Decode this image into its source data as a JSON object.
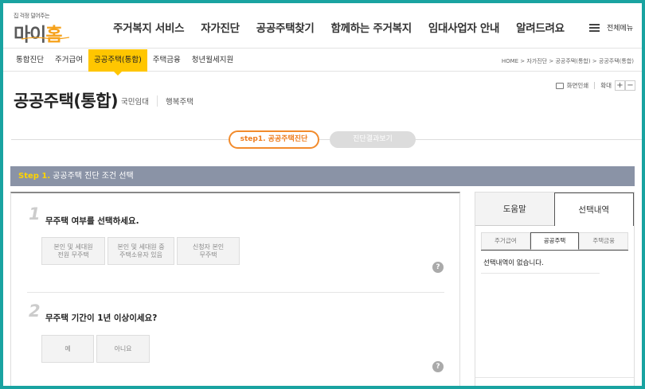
{
  "header": {
    "logo_tagline": "집 걱정 덜어주는",
    "logo_text_a": "마이",
    "logo_text_b": "홈",
    "nav": [
      {
        "label": "주거복지 서비스",
        "active": false
      },
      {
        "label": "자가진단",
        "active": true
      },
      {
        "label": "공공주택찾기",
        "active": false
      },
      {
        "label": "함께하는 주거복지",
        "active": false
      },
      {
        "label": "임대사업자 안내",
        "active": false
      },
      {
        "label": "알려드려요",
        "active": false
      }
    ],
    "all_menu_label": "전체메뉴"
  },
  "subnav": {
    "items": [
      {
        "label": "통합진단",
        "active": false
      },
      {
        "label": "주거급여",
        "active": false
      },
      {
        "label": "공공주택(통합)",
        "active": true
      },
      {
        "label": "주택금융",
        "active": false
      },
      {
        "label": "청년월세지원",
        "active": false
      }
    ],
    "breadcrumb": "HOME > 자가진단 > 공공주택(통합) > 공공주택(통합)"
  },
  "page": {
    "title": "공공주택(통합)",
    "links": [
      "국민임대",
      "행복주택"
    ],
    "print_label": "화면인쇄",
    "zoom_label": "확대",
    "zoom_in": "+",
    "zoom_out": "−"
  },
  "steps": {
    "step1": "step1. 공공주택진단",
    "step2": "진단결과보기"
  },
  "section": {
    "step_tag": "Step 1.",
    "title": "공공주택 진단 조건 선택"
  },
  "questions": [
    {
      "number": "1",
      "text": "무주택 여부를 선택하세요.",
      "options": [
        "본인 및 세대원\n전원 무주택",
        "본인 및 세대원 중\n주택소유자 있음",
        "신청자 본인\n무주택"
      ]
    },
    {
      "number": "2",
      "text": "무주택 기간이 1년 이상이세요?",
      "options": [
        "예",
        "아니요"
      ]
    }
  ],
  "help_symbol": "?",
  "side": {
    "tabs": [
      {
        "label": "도움말",
        "active": false
      },
      {
        "label": "선택내역",
        "active": true
      }
    ],
    "sub_tabs": [
      {
        "label": "주거급여",
        "active": false
      },
      {
        "label": "공공주택",
        "active": true
      },
      {
        "label": "주택금융",
        "active": false
      }
    ],
    "empty_message": "선택내역이 없습니다."
  },
  "colors": {
    "frame_border": "#19a3a1",
    "accent_yellow": "#ffc600",
    "step_orange": "#f28b2c",
    "section_bar": "#8a93a6"
  }
}
